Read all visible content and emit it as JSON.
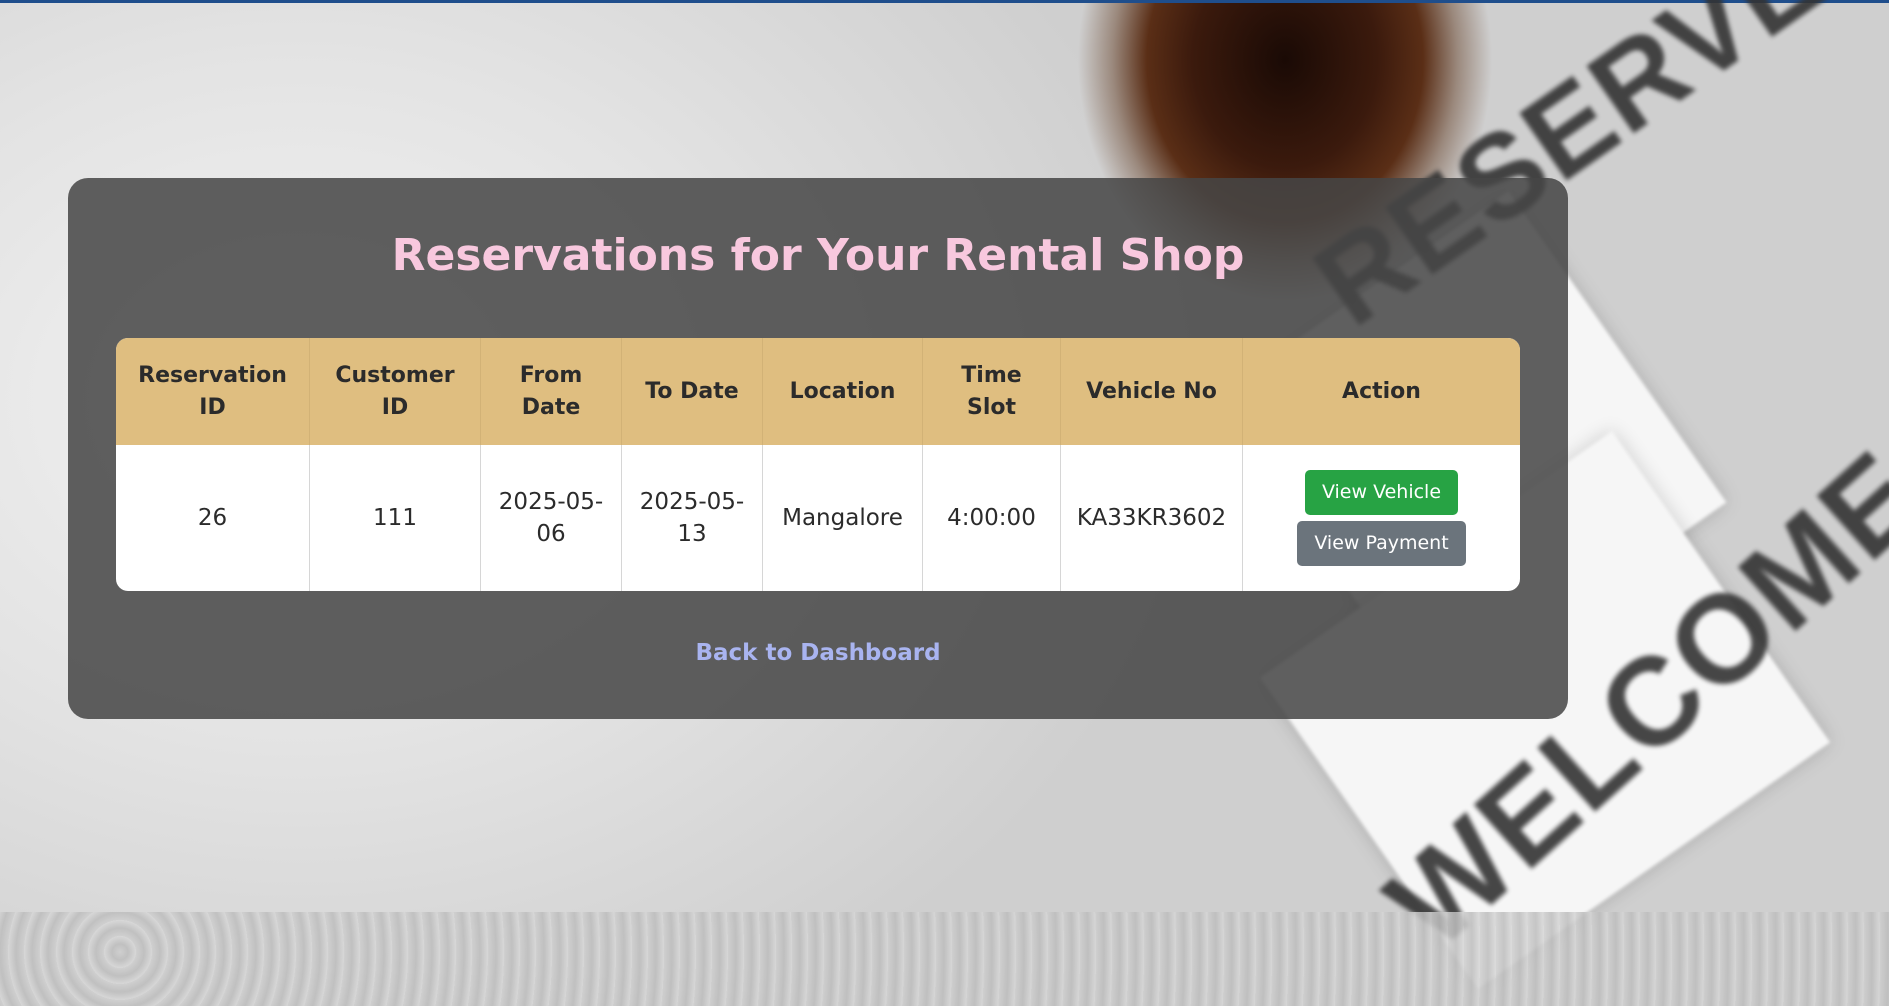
{
  "page": {
    "title": "Reservations for Your Rental Shop",
    "back_link": "Back to Dashboard"
  },
  "background": {
    "sign_text_1": "RESERVED",
    "sign_text_2": "WELCOME"
  },
  "table": {
    "headers": {
      "reservation_id": "Reservation ID",
      "customer_id": "Customer ID",
      "from_date": "From Date",
      "to_date": "To Date",
      "location": "Location",
      "time_slot": "Time Slot",
      "vehicle_no": "Vehicle No",
      "action": "Action"
    },
    "rows": [
      {
        "reservation_id": "26",
        "customer_id": "111",
        "from_date": "2025-05-06",
        "to_date": "2025-05-13",
        "location": "Mangalore",
        "time_slot": "4:00:00",
        "vehicle_no": "KA33KR3602",
        "view_vehicle_label": "View Vehicle",
        "view_payment_label": "View Payment"
      }
    ]
  },
  "colors": {
    "title": "#f8c8de",
    "table_header": "#dfbe80",
    "view_vehicle_button": "#27a344",
    "view_payment_button": "#6b747c",
    "back_link": "#a9b4f0",
    "top_bar": "#1f4e8c"
  }
}
